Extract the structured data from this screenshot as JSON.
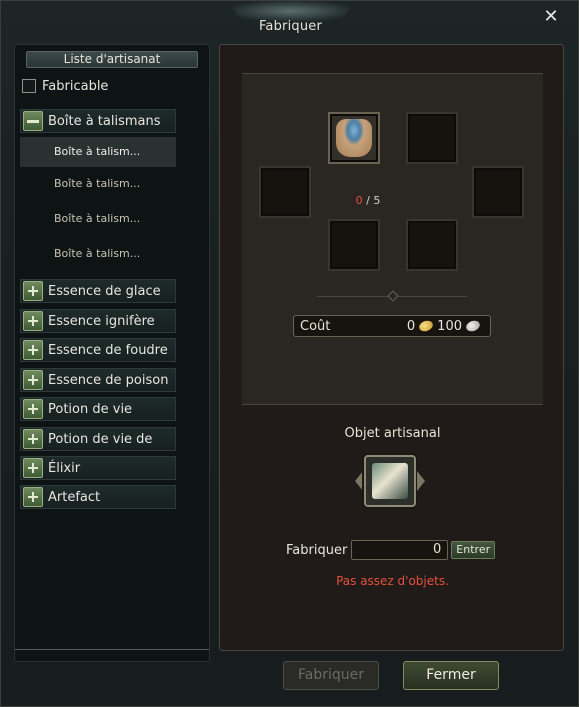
{
  "window": {
    "title": "Fabriquer",
    "close": "✕"
  },
  "left": {
    "header": "Liste d'artisanat",
    "filter_label": "Fabricable",
    "filter_checked": false,
    "expanded_category": {
      "label": "Boîte à talismans",
      "icon": "minus-icon"
    },
    "sub_items": [
      "Boîte à talism...",
      "Boîte à talism...",
      "Boîte à talism...",
      "Boîte à talism..."
    ],
    "categories": [
      "Essence de glace",
      "Essence ignifère",
      "Essence de foudre",
      "Essence de poison",
      "Potion de vie",
      "Potion de vie de",
      "Élixir",
      "Artefact"
    ]
  },
  "recipe": {
    "ingredient_count_have": "0",
    "ingredient_count_sep": " / ",
    "ingredient_count_need": "5",
    "cost_label": "Coût",
    "cost_gold": "0",
    "cost_silver": "100"
  },
  "result": {
    "label": "Objet artisanal",
    "quantity_label": "Fabriquer",
    "quantity_value": "0",
    "enter_label": "Entrer",
    "warning": "Pas assez d'objets."
  },
  "buttons": {
    "craft": "Fabriquer",
    "close": "Fermer"
  },
  "colors": {
    "warning": "#e5503d",
    "accent": "#6a6351"
  }
}
